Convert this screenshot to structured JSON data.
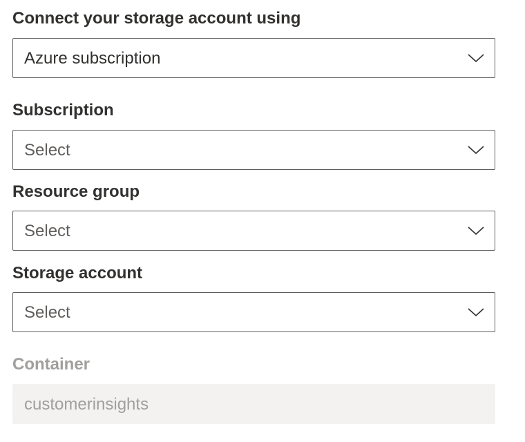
{
  "connect_using": {
    "label": "Connect your storage account using",
    "value": "Azure subscription"
  },
  "subscription": {
    "label": "Subscription",
    "value": "Select"
  },
  "resource_group": {
    "label": "Resource group",
    "value": "Select"
  },
  "storage_account": {
    "label": "Storage account",
    "value": "Select"
  },
  "container": {
    "label": "Container",
    "value": "customerinsights",
    "disabled": true
  },
  "icons": {
    "dropdown_chevron": "chevron-down-icon"
  },
  "colors": {
    "text": "#323130",
    "border": "#605e5c",
    "disabled_text": "#a19f9d",
    "disabled_bg": "#f3f2f1"
  }
}
